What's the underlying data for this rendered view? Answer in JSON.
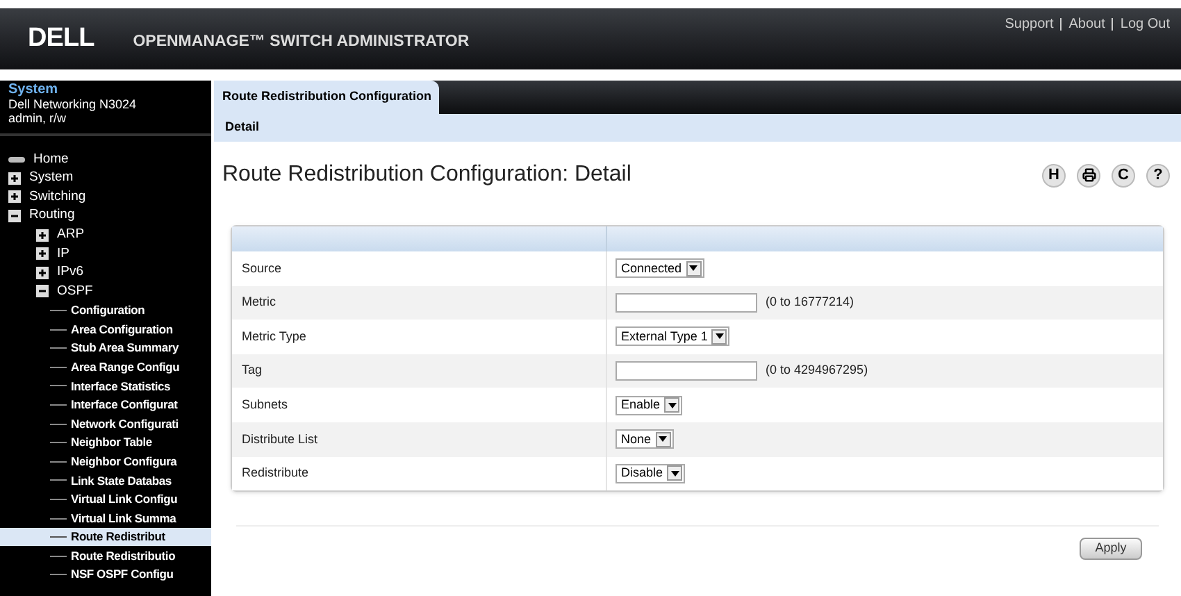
{
  "header": {
    "logo": "DELL",
    "title": "OPENMANAGE™ SWITCH ADMINISTRATOR",
    "links": [
      "Support",
      "About",
      "Log Out"
    ]
  },
  "system": {
    "title": "System",
    "device": "Dell Networking N3024",
    "user": "admin, r/w"
  },
  "tree": [
    {
      "label": "Home",
      "kind": "home",
      "selected": false
    },
    {
      "label": "System",
      "kind": "folder",
      "expanded": false,
      "selected": false
    },
    {
      "label": "Switching",
      "kind": "folder",
      "expanded": false,
      "selected": false
    },
    {
      "label": "Routing",
      "kind": "folder",
      "expanded": true,
      "selected": false,
      "children": [
        {
          "label": "ARP",
          "kind": "folder",
          "expanded": false,
          "selected": false
        },
        {
          "label": "IP",
          "kind": "folder",
          "expanded": false,
          "selected": false
        },
        {
          "label": "IPv6",
          "kind": "folder",
          "expanded": false,
          "selected": false
        },
        {
          "label": "OSPF",
          "kind": "folder",
          "expanded": true,
          "selected": false,
          "children": [
            {
              "label": "Configuration",
              "kind": "leaf",
              "selected": false
            },
            {
              "label": "Area Configuration",
              "kind": "leaf",
              "selected": false
            },
            {
              "label": "Stub Area Summary",
              "kind": "leaf",
              "selected": false
            },
            {
              "label": "Area Range Configu",
              "kind": "leaf",
              "selected": false
            },
            {
              "label": "Interface Statistics",
              "kind": "leaf",
              "selected": false
            },
            {
              "label": "Interface Configurat",
              "kind": "leaf",
              "selected": false
            },
            {
              "label": "Network Configurati",
              "kind": "leaf",
              "selected": false
            },
            {
              "label": "Neighbor Table",
              "kind": "leaf",
              "selected": false
            },
            {
              "label": "Neighbor Configura",
              "kind": "leaf",
              "selected": false
            },
            {
              "label": "Link State Databas",
              "kind": "leaf",
              "selected": false
            },
            {
              "label": "Virtual Link Configu",
              "kind": "leaf",
              "selected": false
            },
            {
              "label": "Virtual Link Summa",
              "kind": "leaf",
              "selected": false
            },
            {
              "label": "Route Redistribut",
              "kind": "leaf",
              "selected": true
            },
            {
              "label": "Route Redistributio",
              "kind": "leaf",
              "selected": false
            },
            {
              "label": "NSF OSPF Configu",
              "kind": "leaf",
              "selected": false
            }
          ]
        }
      ]
    }
  ],
  "tabs": [
    {
      "label": "Route Redistribution Configuration",
      "selected": true
    }
  ],
  "subtabs": [
    {
      "label": "Detail",
      "selected": true
    }
  ],
  "page_title": "Route Redistribution Configuration: Detail",
  "toolbar": [
    {
      "kind": "glyph",
      "label": "H"
    },
    {
      "kind": "printer"
    },
    {
      "kind": "glyph",
      "label": "C"
    },
    {
      "kind": "glyph",
      "label": "?"
    }
  ],
  "form": [
    {
      "label": "Source",
      "kind": "select",
      "value": "Connected"
    },
    {
      "label": "Metric",
      "kind": "text",
      "hint": "(0 to 16777214)"
    },
    {
      "label": "Metric Type",
      "kind": "select",
      "value": "External Type 1"
    },
    {
      "label": "Tag",
      "kind": "text",
      "hint": "(0 to 4294967295)"
    },
    {
      "label": "Subnets",
      "kind": "select",
      "value": "Enable"
    },
    {
      "label": "Distribute List",
      "kind": "select",
      "value": "None"
    },
    {
      "label": "Redistribute",
      "kind": "select",
      "value": "Disable"
    }
  ],
  "apply": "Apply"
}
